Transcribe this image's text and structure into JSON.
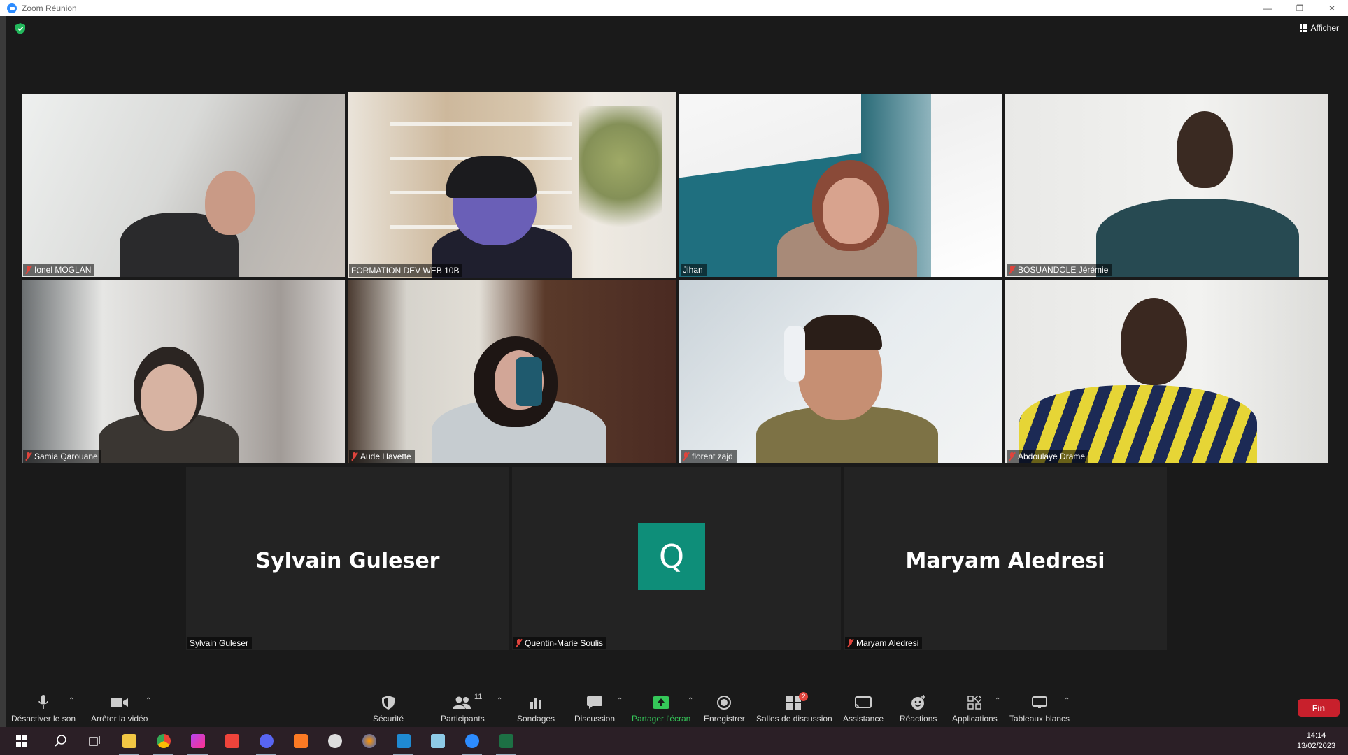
{
  "window": {
    "title": "Zoom Réunion"
  },
  "header": {
    "view_label": "Afficher"
  },
  "participants": [
    {
      "name": "Ionel MOGLAN",
      "muted": true
    },
    {
      "name": "FORMATION DEV WEB 10B",
      "muted": false,
      "active_speaker": true
    },
    {
      "name": "Jihan",
      "muted": false
    },
    {
      "name": "BOSUANDOLE Jérémie",
      "muted": true
    },
    {
      "name": "Samia Qarouane",
      "muted": true
    },
    {
      "name": "Aude Havette",
      "muted": true
    },
    {
      "name": "florent zajd",
      "muted": true
    },
    {
      "name": "Abdoulaye Drame",
      "muted": true
    }
  ],
  "no_video": [
    {
      "display_name": "Sylvain Guleser",
      "tag": "Sylvain Guleser",
      "muted": false
    },
    {
      "avatar_letter": "Q",
      "tag": "Quentin-Marie Soulis",
      "muted": true
    },
    {
      "display_name": "Maryam Aledresi",
      "tag": "Maryam Aledresi",
      "muted": true
    }
  ],
  "toolbar": {
    "mute": "Désactiver le son",
    "video": "Arrêter la vidéo",
    "security": "Sécurité",
    "participants": "Participants",
    "participants_count": "11",
    "polls": "Sondages",
    "chat": "Discussion",
    "share": "Partager l'écran",
    "record": "Enregistrer",
    "breakout": "Salles de discussion",
    "breakout_badge": "2",
    "assist": "Assistance",
    "reactions": "Réactions",
    "apps": "Applications",
    "whiteboards": "Tableaux blancs",
    "end": "Fin"
  },
  "taskbar": {
    "time": "14:14",
    "date": "13/02/2023"
  },
  "colors": {
    "active_border": "#c8e64c",
    "end_button": "#c8202c",
    "share_green": "#35c759",
    "avatar_q": "#0e8e79"
  }
}
